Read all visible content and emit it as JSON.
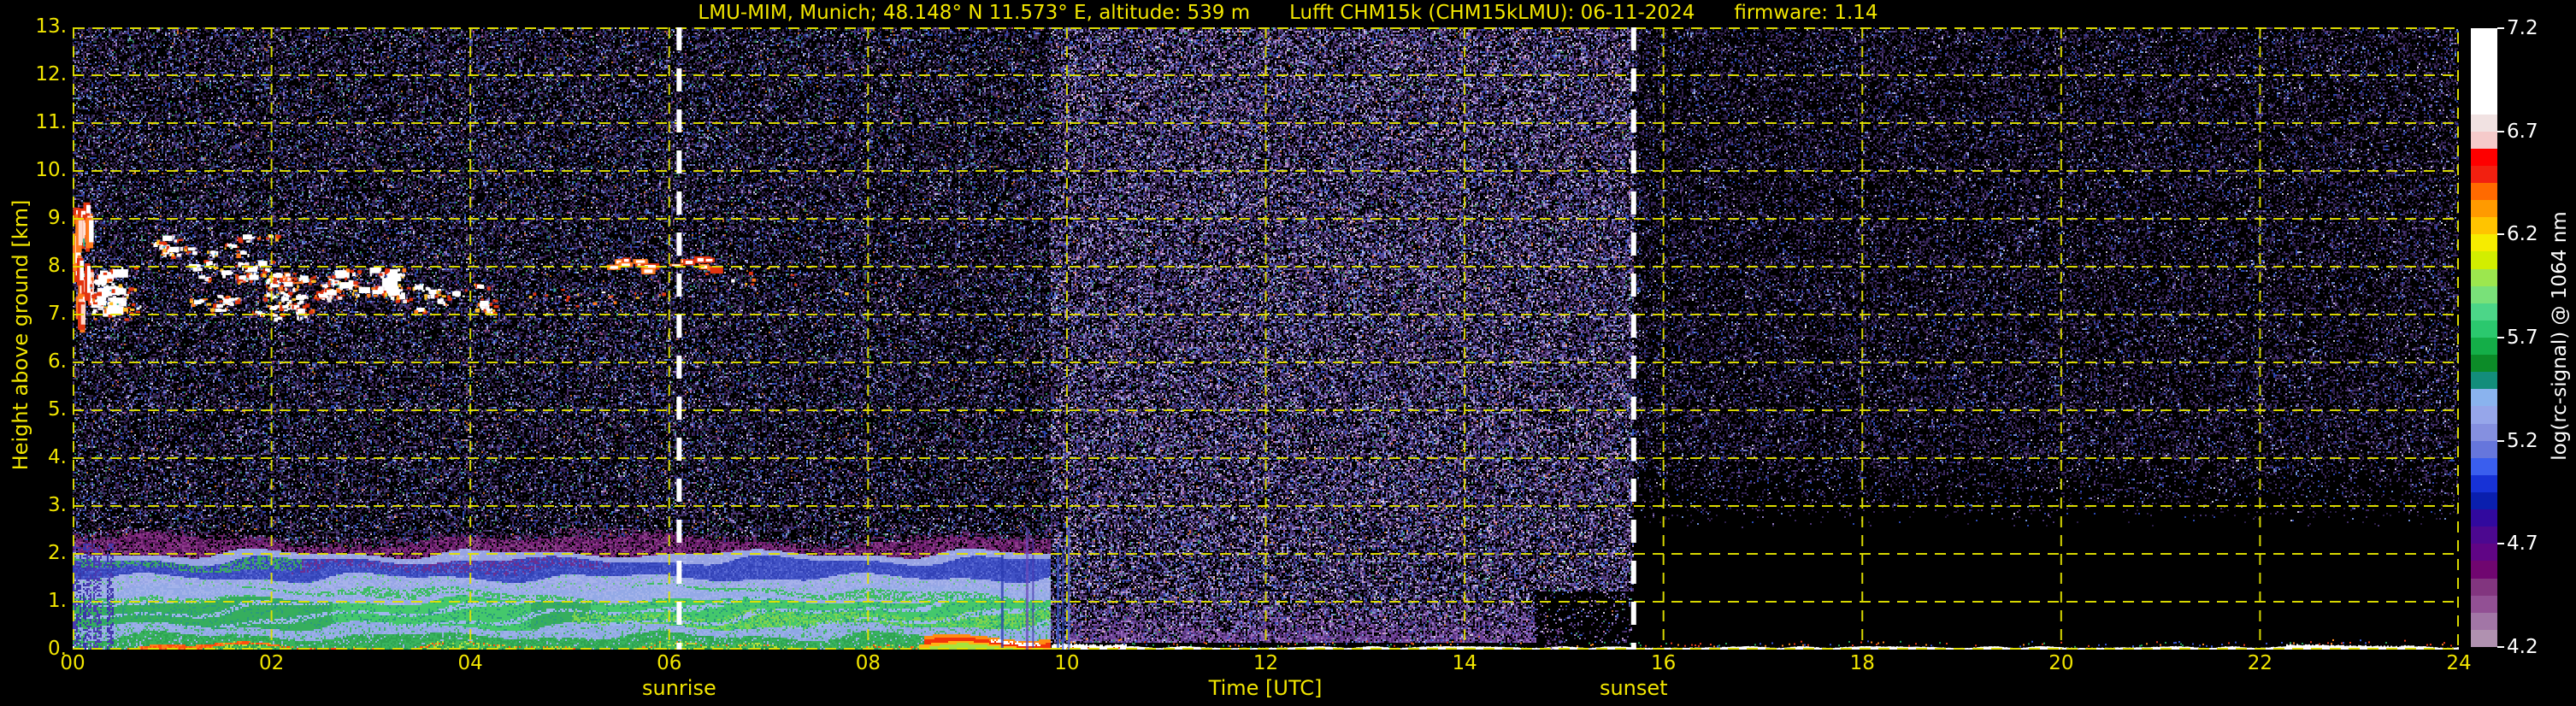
{
  "header": {
    "title_segments": [
      "LMU-MIM, Munich; 48.148° N 11.573° E, altitude: 539 m",
      "Lufft CHM15k (CHM15kLMU): 06-11-2024",
      "firmware: 1.14"
    ]
  },
  "chart_data": {
    "type": "heatmap",
    "title": "LMU-MIM, Munich; 48.148° N 11.573° E, altitude: 539 m    Lufft CHM15k (CHM15kLMU): 06-11-2024    firmware: 1.14",
    "xlabel": "Time [UTC]",
    "ylabel": "Height above ground [km]",
    "x_ticks": [
      "00",
      "02",
      "04",
      "06",
      "08",
      "10",
      "12",
      "14",
      "16",
      "18",
      "20",
      "22",
      "24"
    ],
    "x_range_hours": [
      0,
      24
    ],
    "y_ticks": [
      "0.",
      "1.",
      "2.",
      "3.",
      "4.",
      "5.",
      "6.",
      "7.",
      "8.",
      "9.",
      "10.",
      "11.",
      "12.",
      "13."
    ],
    "y_range_km": [
      0,
      13
    ],
    "grid": {
      "color": "#e3e300",
      "style": "dashed",
      "x_step_hours": 2,
      "y_step_km": 1
    },
    "sun_events": [
      {
        "label": "sunrise",
        "time_utc": 6.1
      },
      {
        "label": "sunset",
        "time_utc": 15.7
      }
    ],
    "colorbar": {
      "label": "log(rc-signal) @ 1064 nm",
      "tick_labels": [
        "7.2",
        "6.7",
        "6.2",
        "5.7",
        "5.2",
        "4.7",
        "4.2"
      ],
      "value_range": [
        4.2,
        7.2
      ],
      "segment_colors_top_to_bottom": [
        "#ffffff",
        "#ffffff",
        "#ffffff",
        "#ffffff",
        "#ffffff",
        "#f1e2e2",
        "#f5caca",
        "#fe0000",
        "#f22010",
        "#ff6a00",
        "#ff9a00",
        "#ffc400",
        "#f6ec00",
        "#d2ee00",
        "#9ce74e",
        "#79e179",
        "#4cd688",
        "#2bc86e",
        "#14ae48",
        "#0c8b28",
        "#138d7b",
        "#8ab3ee",
        "#96a6ea",
        "#8590e0",
        "#6676dc",
        "#3a5eee",
        "#1732d6",
        "#0a1fae",
        "#31099e",
        "#4c0890",
        "#600585",
        "#700670",
        "#82357f",
        "#925094",
        "#a276a6",
        "#b091b0"
      ]
    },
    "features": {
      "background_noise_regions": [
        {
          "t_hours": [
            0,
            9.83
          ],
          "h_km": [
            2.4,
            13
          ],
          "intensity": "moderate",
          "tone": "dark purple-blue speckle"
        },
        {
          "t_hours": [
            9.83,
            15.7
          ],
          "h_km": [
            0.16,
            13
          ],
          "intensity": "high",
          "tone": "bright purple-lavender daytime speckle"
        },
        {
          "t_hours": [
            15.7,
            24
          ],
          "h_km": [
            2.6,
            13
          ],
          "intensity": "low-fading-toward-ground",
          "tone": "sparse dim purple speckle, black below 3 km"
        }
      ],
      "boundary_layer": {
        "t_hours": [
          0,
          9.83
        ],
        "top_km": 2.3,
        "bands": [
          {
            "h_km": [
              0,
              0.1
            ],
            "color": "#44bc5c",
            "note": "near-ground return; red-orange line ~0.07 km until ~04:00, white before 00:15"
          },
          {
            "h_km": [
              0.1,
              0.3
            ],
            "color": "#38b45e"
          },
          {
            "h_km": [
              0.3,
              0.5
            ],
            "color": "#8ea7e4"
          },
          {
            "h_km": [
              0.5,
              1.05
            ],
            "color": "#3fbc66",
            "note": "brightest green 02:30-04:40 and after 05:00"
          },
          {
            "h_km": [
              1.05,
              1.5
            ],
            "color": "#9bade8"
          },
          {
            "h_km": [
              1.5,
              1.95
            ],
            "color": "#3d4cc2",
            "note": "blue band with purple patches 02:15-05:20"
          },
          {
            "h_km": [
              1.95,
              2.1
            ],
            "color": "#97a3e3"
          },
          {
            "h_km": [
              2.1,
              2.35
            ],
            "color": "#741f74",
            "note": "fuzzy purple capping layer"
          }
        ],
        "surface_hotspot": {
          "t_hours": [
            8.55,
            9.8
          ],
          "h_km": [
            0.08,
            0.34
          ],
          "colors": [
            "#f2330a",
            "#ff8c12",
            "#ffffff"
          ]
        }
      },
      "cirrus_clusters": [
        {
          "t_hours": [
            0.03,
            0.2
          ],
          "h_km": [
            6.9,
            9.25
          ],
          "n": 26,
          "style": "streak-v"
        },
        {
          "t_hours": [
            0.2,
            0.5
          ],
          "h_km": [
            6.95,
            7.95
          ],
          "n": 16,
          "style": "blob-lg"
        },
        {
          "t_hours": [
            0.55,
            0.75
          ],
          "h_km": [
            7.0,
            7.3
          ],
          "n": 5,
          "style": "dots"
        },
        {
          "t_hours": [
            0.85,
            1.05
          ],
          "h_km": [
            8.25,
            8.6
          ],
          "n": 5,
          "style": "blob"
        },
        {
          "t_hours": [
            1.15,
            2.15
          ],
          "h_km": [
            7.7,
            8.65
          ],
          "n": 20,
          "style": "blob"
        },
        {
          "t_hours": [
            1.15,
            2.3
          ],
          "h_km": [
            6.95,
            7.4
          ],
          "n": 14,
          "style": "blob"
        },
        {
          "t_hours": [
            1.95,
            2.65
          ],
          "h_km": [
            7.35,
            8.0
          ],
          "n": 16,
          "style": "blob"
        },
        {
          "t_hours": [
            2.6,
            3.25
          ],
          "h_km": [
            7.45,
            7.95
          ],
          "n": 14,
          "style": "blob-lg"
        },
        {
          "t_hours": [
            3.2,
            4.2
          ],
          "h_km": [
            7.05,
            7.6
          ],
          "n": 12,
          "style": "blob"
        },
        {
          "t_hours": [
            4.2,
            5.2
          ],
          "h_km": [
            7.15,
            7.55
          ],
          "n": 9,
          "style": "dots"
        },
        {
          "t_hours": [
            5.1,
            6.15
          ],
          "h_km": [
            7.25,
            7.5
          ],
          "n": 10,
          "style": "dots"
        },
        {
          "t_hours": [
            5.35,
            6.5
          ],
          "h_km": [
            7.9,
            8.15
          ],
          "n": 16,
          "style": "streak-h"
        },
        {
          "t_hours": [
            6.35,
            7.35
          ],
          "h_km": [
            7.55,
            8.0
          ],
          "n": 10,
          "style": "dots"
        },
        {
          "t_hours": [
            7.4,
            8.6
          ],
          "h_km": [
            7.45,
            7.8
          ],
          "n": 6,
          "style": "dots-faint"
        }
      ],
      "cloud_palette": [
        "#ffffff",
        "#e23410",
        "#ff7a1e",
        "#ffc028",
        "#34b88c"
      ],
      "surface_return": {
        "t_hours": [
          9.85,
          24
        ],
        "h_km": [
          0,
          0.12
        ],
        "color": "#ffffff"
      },
      "aerosol_plume": {
        "t_hours": [
          10.0,
          14.72
        ],
        "h_km": [
          0.12,
          1.2
        ],
        "colors": [
          "#6a3d92",
          "#7d4fa5",
          "#8f62b5",
          "#5a2f80",
          "#a478c8",
          "#49256b"
        ]
      },
      "vertical_streaks": [
        {
          "t": 9.35,
          "top_km": 2.0,
          "color": "#2a3ab0",
          "w": 3
        },
        {
          "t": 9.6,
          "top_km": 2.55,
          "color": "#6a4ab8",
          "w": 3
        },
        {
          "t": 9.66,
          "top_km": 2.3,
          "color": "#4a3ab0",
          "w": 2
        },
        {
          "t": 9.91,
          "top_km": 2.2,
          "color": "#3a55c8",
          "w": 3
        },
        {
          "t": 9.96,
          "top_km": 2.1,
          "color": "#3a55c8",
          "w": 2
        },
        {
          "t": 10.02,
          "top_km": 2.6,
          "color": "#5a70d0",
          "w": 3
        }
      ]
    }
  },
  "colors": {
    "axis_text": "#f2e600",
    "colorbar_text": "#ffffff",
    "background": "#000000",
    "sun_line": "#ffffff"
  }
}
